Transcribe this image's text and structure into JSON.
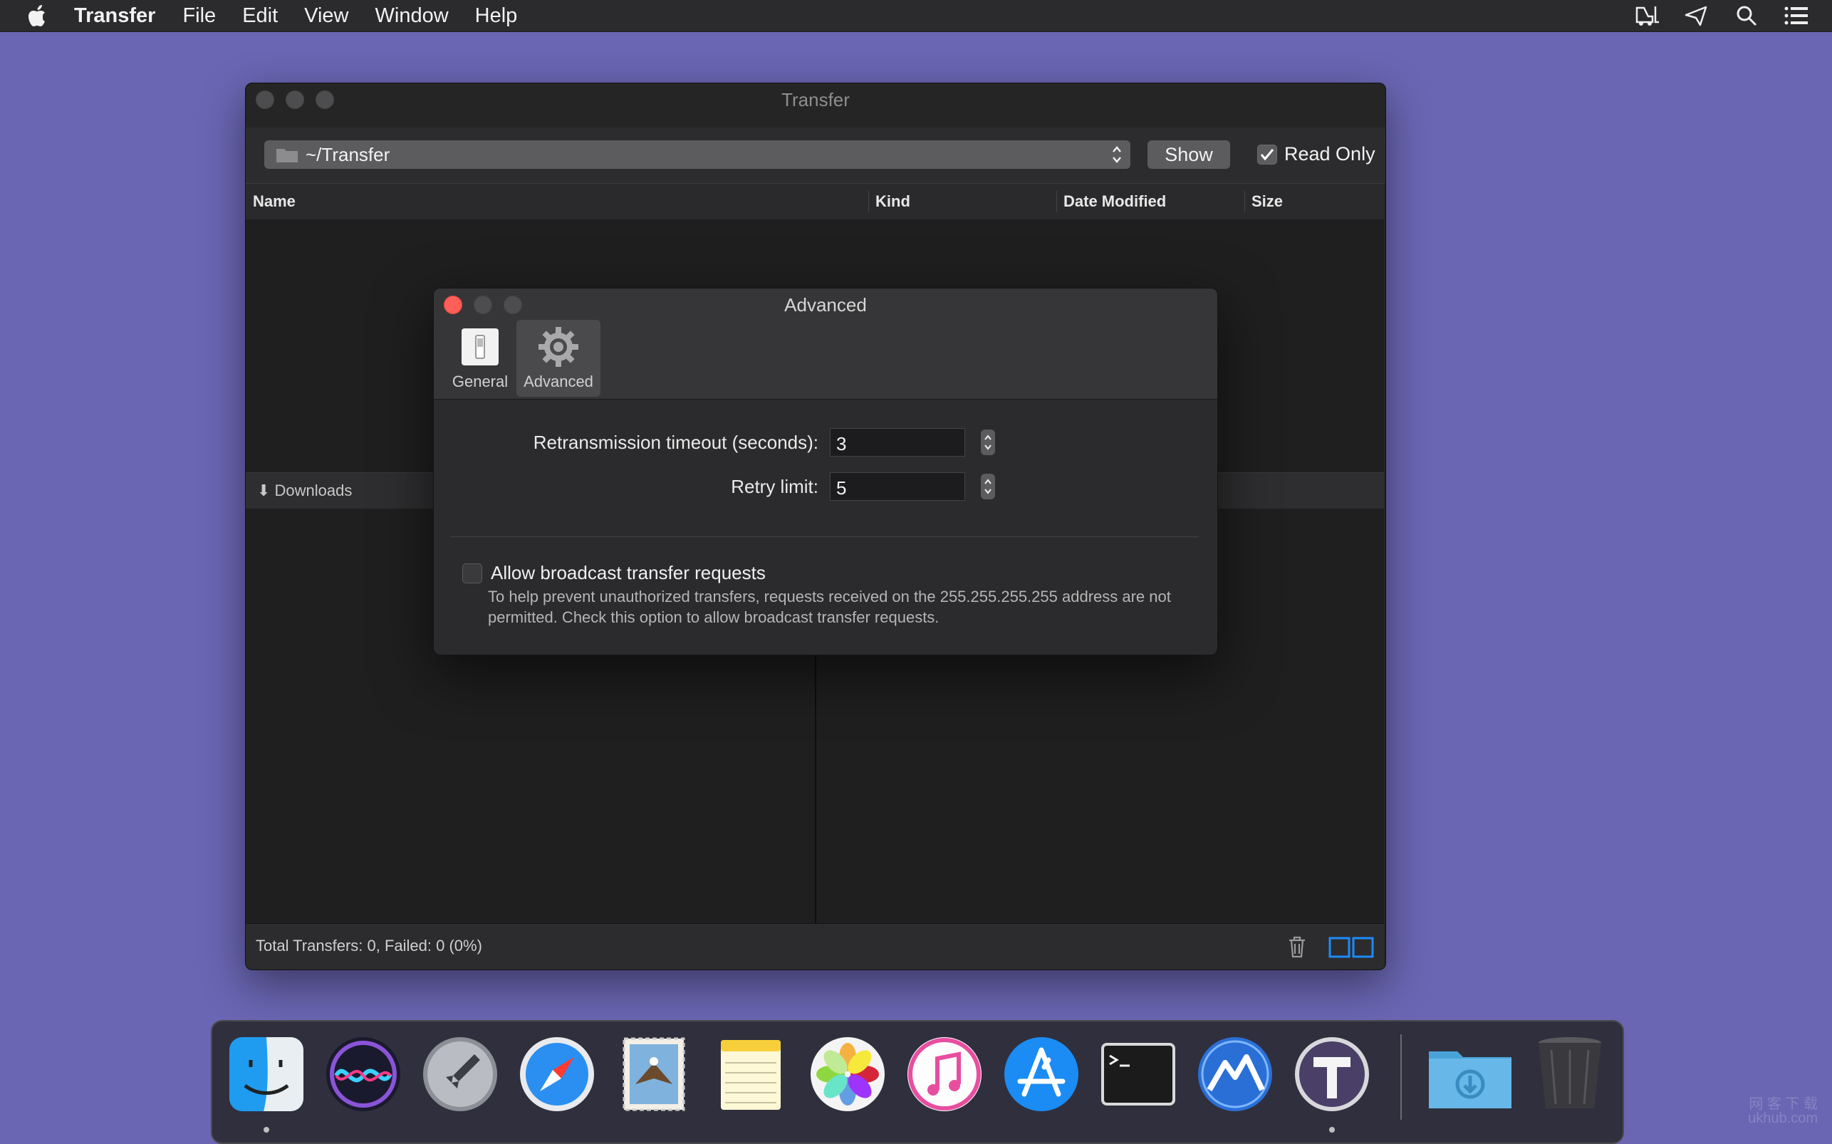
{
  "menubar": {
    "app": "Transfer",
    "items": [
      "File",
      "Edit",
      "View",
      "Window",
      "Help"
    ]
  },
  "main_window": {
    "title": "Transfer",
    "path": "~/Transfer",
    "show_label": "Show",
    "read_only_label": "Read Only",
    "read_only_checked": true,
    "columns": [
      "Name",
      "Kind",
      "Date Modified",
      "Size"
    ],
    "downloads_label": "⬇ Downloads",
    "status": "Total Transfers: 0, Failed: 0 (0%)"
  },
  "prefs": {
    "title": "Advanced",
    "tabs": [
      "General",
      "Advanced"
    ],
    "selected_tab": "Advanced",
    "timeout_label": "Retransmission timeout (seconds):",
    "timeout_value": "3",
    "retry_label": "Retry limit:",
    "retry_value": "5",
    "broadcast_label": "Allow broadcast transfer requests",
    "broadcast_checked": false,
    "help_text": "To help prevent unauthorized transfers, requests received on the 255.255.255.255 address are not permitted. Check this option to allow broadcast transfer requests."
  },
  "dock": {
    "apps": [
      "finder-icon",
      "siri-icon",
      "launchpad-icon",
      "safari-icon",
      "mail-icon",
      "notes-icon",
      "photos-icon",
      "itunes-icon",
      "app-store-icon",
      "terminal-icon",
      "monodraw-icon",
      "transfer-icon",
      "downloads-folder-icon",
      "trash-icon"
    ],
    "accent": "#1d8bfa"
  },
  "watermark": {
    "line1": "网 客 下 载",
    "line2": "ukhub.com"
  },
  "colors": {
    "desktop": "#6a66b3",
    "close_red": "#fe5f57",
    "window_bg": "#252526"
  }
}
